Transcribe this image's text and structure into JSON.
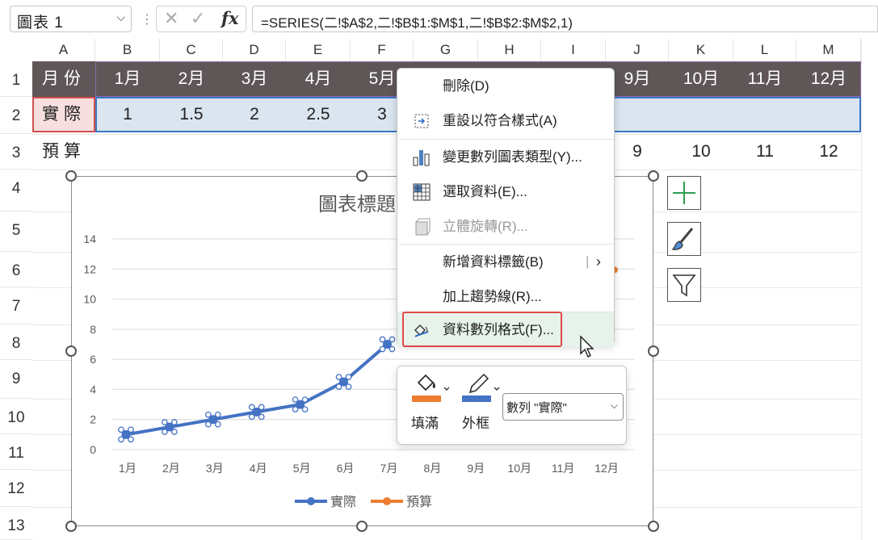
{
  "formula_bar": {
    "name_box": "圖表 1",
    "cancel_glyph": "✕",
    "enter_glyph": "✓",
    "fx_label": "fx",
    "formula": "=SERIES(二!$A$2,二!$B$1:$M$1,二!$B$2:$M$2,1)"
  },
  "columns": [
    "A",
    "B",
    "C",
    "D",
    "E",
    "F",
    "G",
    "H",
    "I",
    "J",
    "K",
    "L",
    "M"
  ],
  "rows": [
    "1",
    "2",
    "3",
    "4",
    "5",
    "6",
    "7",
    "8",
    "9",
    "10",
    "11",
    "12",
    "13"
  ],
  "sheet": {
    "a1": "月份",
    "a2": "實際",
    "a3": "預算",
    "months_visible": [
      "1月",
      "2月",
      "3月",
      "4月",
      "5月"
    ],
    "months_right": [
      "9月",
      "10月",
      "11月",
      "12月"
    ],
    "actual_visible": [
      "1",
      "1.5",
      "2",
      "2.5",
      "3"
    ],
    "budget_right": [
      "9",
      "10",
      "11",
      "12"
    ]
  },
  "chart": {
    "title_partial": "圖表標題",
    "y_ticks": [
      "14",
      "12",
      "10",
      "8",
      "6",
      "4",
      "2",
      "0"
    ],
    "x_labels": [
      "1月",
      "2月",
      "3月",
      "4月",
      "5月",
      "6月",
      "7月",
      "8月",
      "9月",
      "10月",
      "11月",
      "12月"
    ],
    "legend": [
      "實際",
      "預算"
    ],
    "colors": {
      "actual": "#4472c4",
      "budget": "#ed7d31"
    }
  },
  "chart_data": {
    "type": "line",
    "title": "圖表標題",
    "categories": [
      "1月",
      "2月",
      "3月",
      "4月",
      "5月",
      "6月",
      "7月",
      "8月",
      "9月",
      "10月",
      "11月",
      "12月"
    ],
    "series": [
      {
        "name": "實際",
        "values": [
          1,
          1.5,
          2,
          2.5,
          3,
          4.5,
          7
        ]
      },
      {
        "name": "預算",
        "values": [
          null,
          null,
          null,
          null,
          null,
          null,
          null,
          null,
          null,
          null,
          null,
          12
        ]
      }
    ],
    "ylim": [
      0,
      14
    ],
    "grid": true,
    "legend": "bottom"
  },
  "context_menu": {
    "items": [
      {
        "label": "刪除(D)",
        "icon": "none",
        "disabled": false
      },
      {
        "label": "重設以符合樣式(A)",
        "icon": "reset-style-icon",
        "disabled": false
      },
      {
        "label": "變更數列圖表類型(Y)...",
        "icon": "chart-type-icon",
        "disabled": false
      },
      {
        "label": "選取資料(E)...",
        "icon": "select-data-icon",
        "disabled": false
      },
      {
        "label": "立體旋轉(R)...",
        "icon": "3d-rotation-icon",
        "disabled": true
      },
      {
        "label": "新增資料標籤(B)",
        "icon": "none",
        "disabled": false
      },
      {
        "label": "加上趨勢線(R)...",
        "icon": "none",
        "disabled": false
      },
      {
        "label": "資料數列格式(F)...",
        "icon": "format-series-icon",
        "disabled": false
      }
    ]
  },
  "mini_toolbar": {
    "fill_label": "填滿",
    "outline_label": "外框",
    "series_select": "數列 \"實際\"",
    "fill_color": "#ed7d31",
    "outline_color": "#4472c4"
  }
}
